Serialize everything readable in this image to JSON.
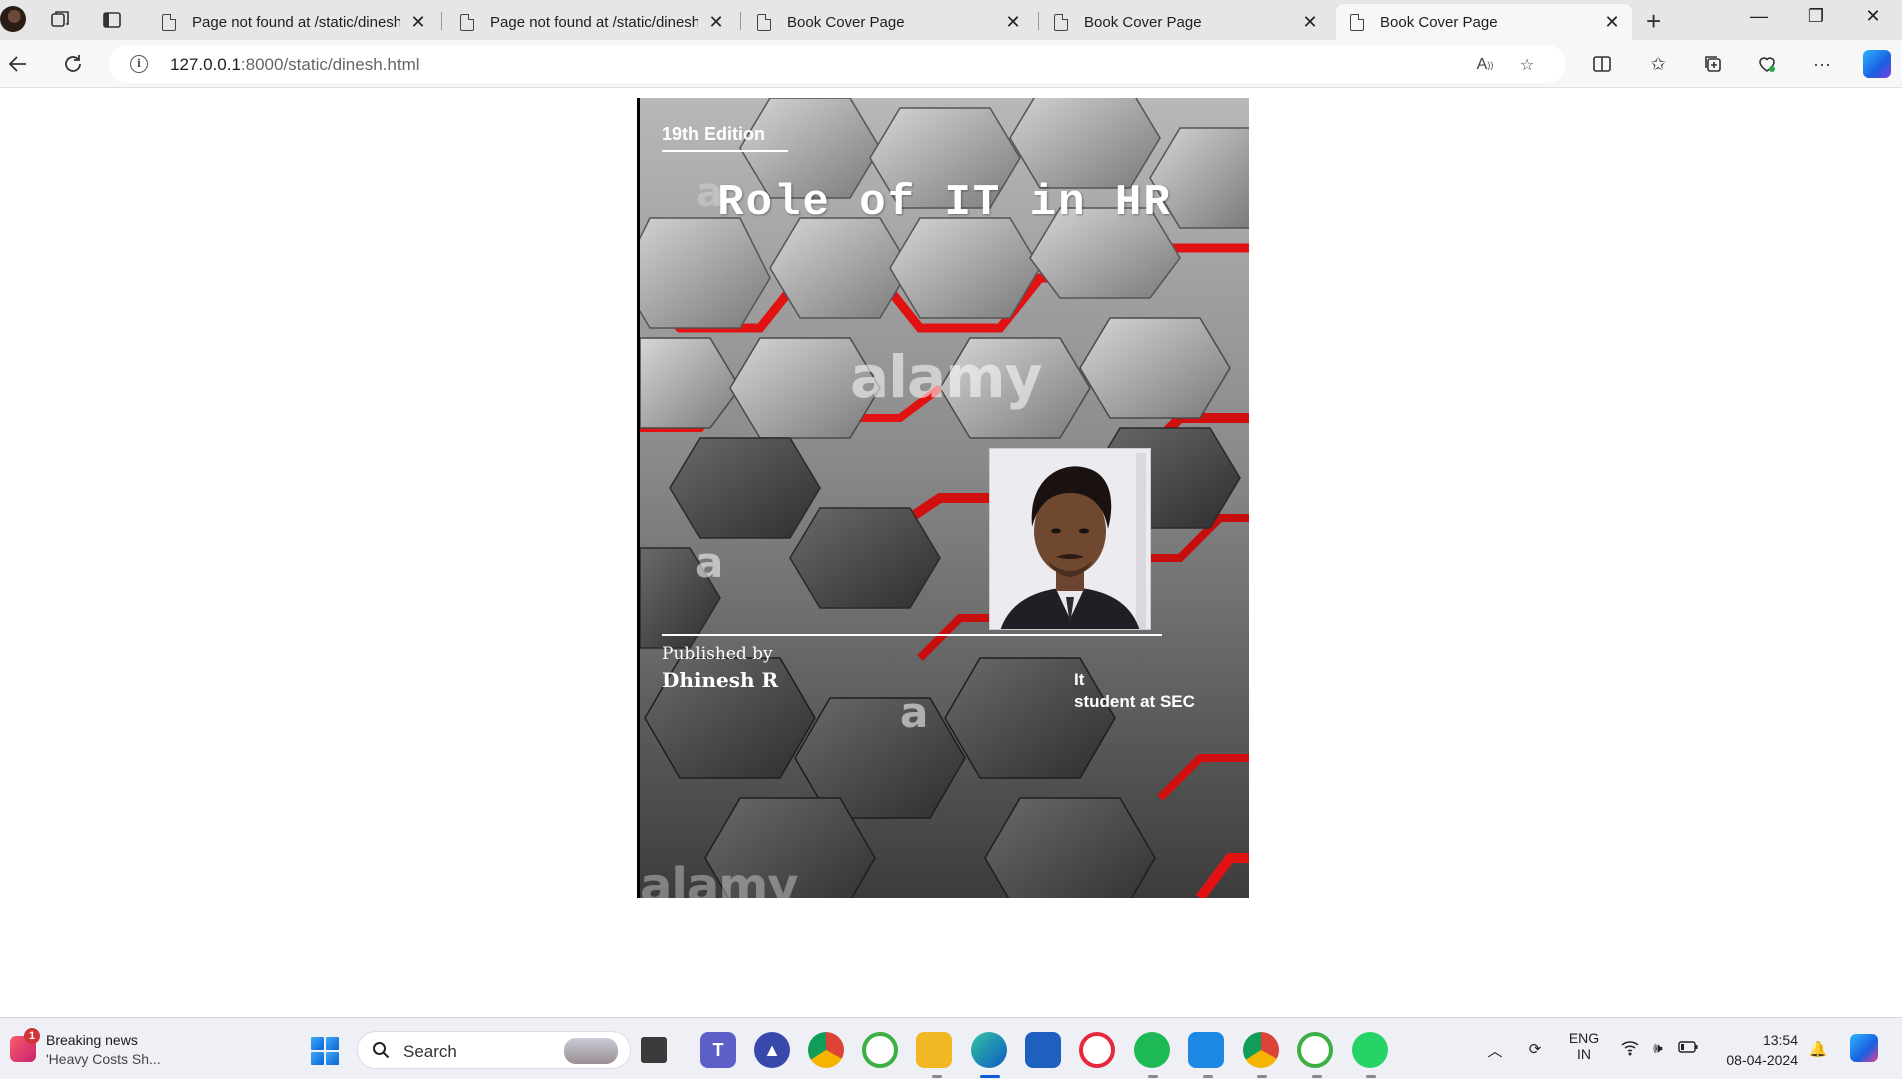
{
  "tabs": [
    {
      "title": "Page not found at /static/dinesh.",
      "active": false
    },
    {
      "title": "Page not found at /static/dinesh.",
      "active": false
    },
    {
      "title": "Book Cover Page",
      "active": false
    },
    {
      "title": "Book Cover Page",
      "active": false
    },
    {
      "title": "Book Cover Page",
      "active": true
    }
  ],
  "address_bar": {
    "host": "127.0.0.1",
    "rest": ":8000/static/dinesh.html"
  },
  "cover": {
    "edition": "19th Edition",
    "title": "Role of IT in HR",
    "published_by_label": "Published by",
    "author": "Dhinesh R",
    "role_line1": "It",
    "role_line2": "student at SEC",
    "watermarks": [
      "alamy",
      "a",
      "a",
      "a",
      "alamy"
    ],
    "colors": {
      "accent": "#e01010",
      "hex_face": "#9a9a9a",
      "hex_dark": "#3a3a3a"
    }
  },
  "taskbar": {
    "news_badge": "1",
    "news_title": "Breaking news",
    "news_subtitle": "'Heavy Costs Sh...",
    "search_placeholder": "Search",
    "apps": [
      {
        "name": "task-view-icon",
        "label": ""
      },
      {
        "name": "teams-icon",
        "label": "T"
      },
      {
        "name": "arc-icon",
        "label": ""
      },
      {
        "name": "chrome-icon",
        "label": ""
      },
      {
        "name": "green-circle-icon",
        "label": ""
      },
      {
        "name": "file-explorer-icon",
        "label": ""
      },
      {
        "name": "edge-icon",
        "label": ""
      },
      {
        "name": "store-icon",
        "label": ""
      },
      {
        "name": "opera-icon",
        "label": ""
      },
      {
        "name": "spotify-icon",
        "label": ""
      },
      {
        "name": "vscode-icon",
        "label": ""
      },
      {
        "name": "chrome-profile-icon",
        "label": ""
      },
      {
        "name": "green-circle-icon-2",
        "label": ""
      },
      {
        "name": "whatsapp-icon",
        "label": ""
      }
    ],
    "lang_line1": "ENG",
    "lang_line2": "IN",
    "time": "13:54",
    "date": "08-04-2024"
  }
}
